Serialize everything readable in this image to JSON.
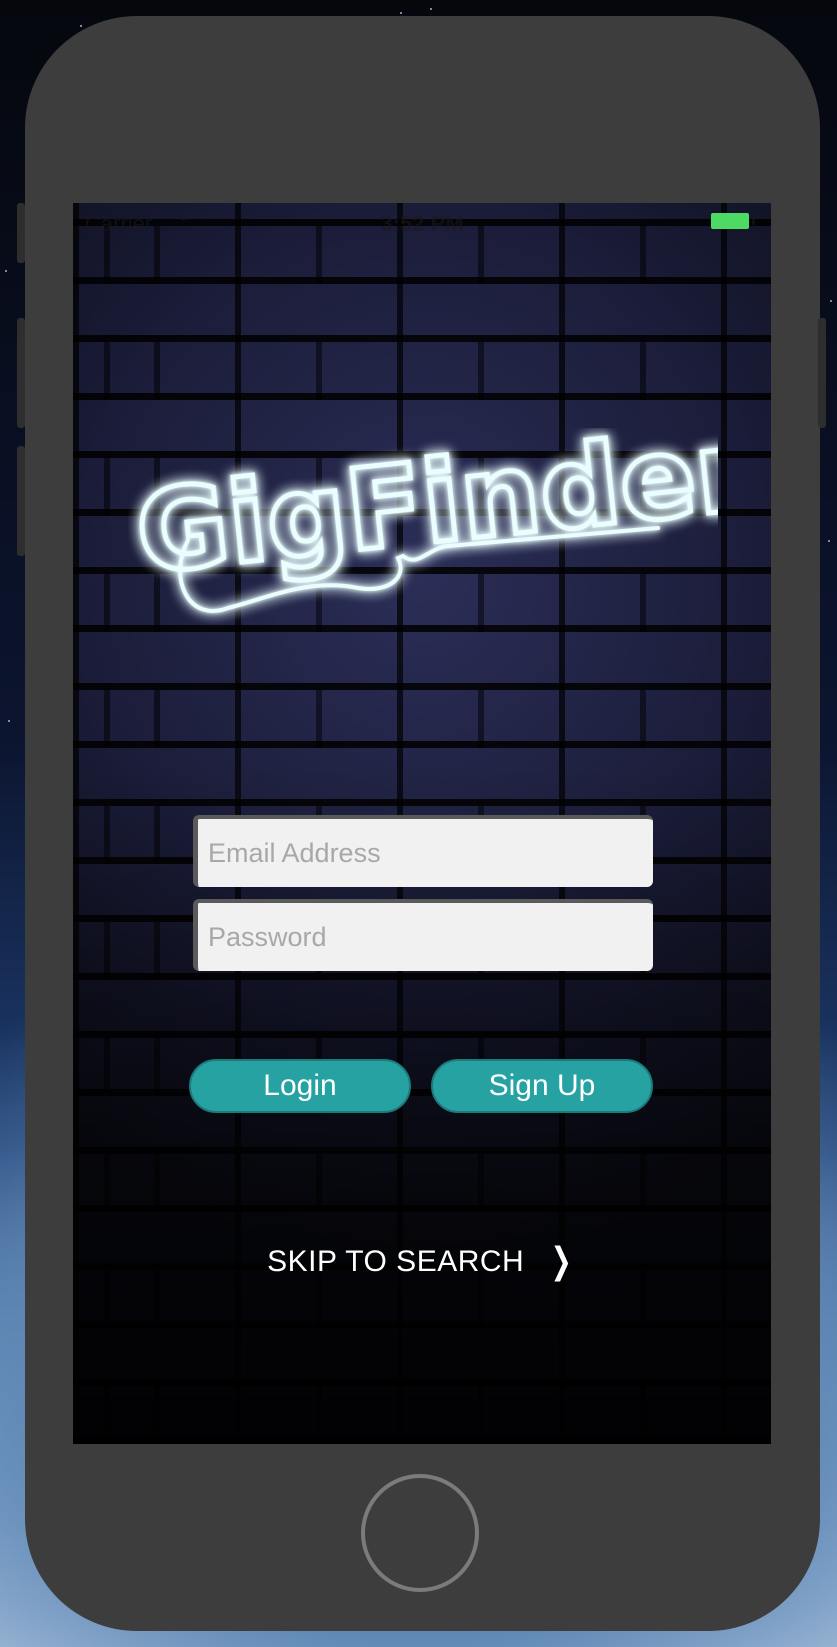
{
  "status_bar": {
    "carrier": "Carrier",
    "time": "3:52 PM",
    "battery_color": "#4cd964"
  },
  "logo": {
    "text": "GigFinder",
    "glow_color": "#5ff3ff"
  },
  "form": {
    "email_placeholder": "Email Address",
    "email_value": "",
    "password_placeholder": "Password",
    "password_value": ""
  },
  "buttons": {
    "login_label": "Login",
    "signup_label": "Sign Up",
    "accent_color": "#27a2a3"
  },
  "skip": {
    "label": "SKIP TO SEARCH",
    "chevron": "❯"
  }
}
